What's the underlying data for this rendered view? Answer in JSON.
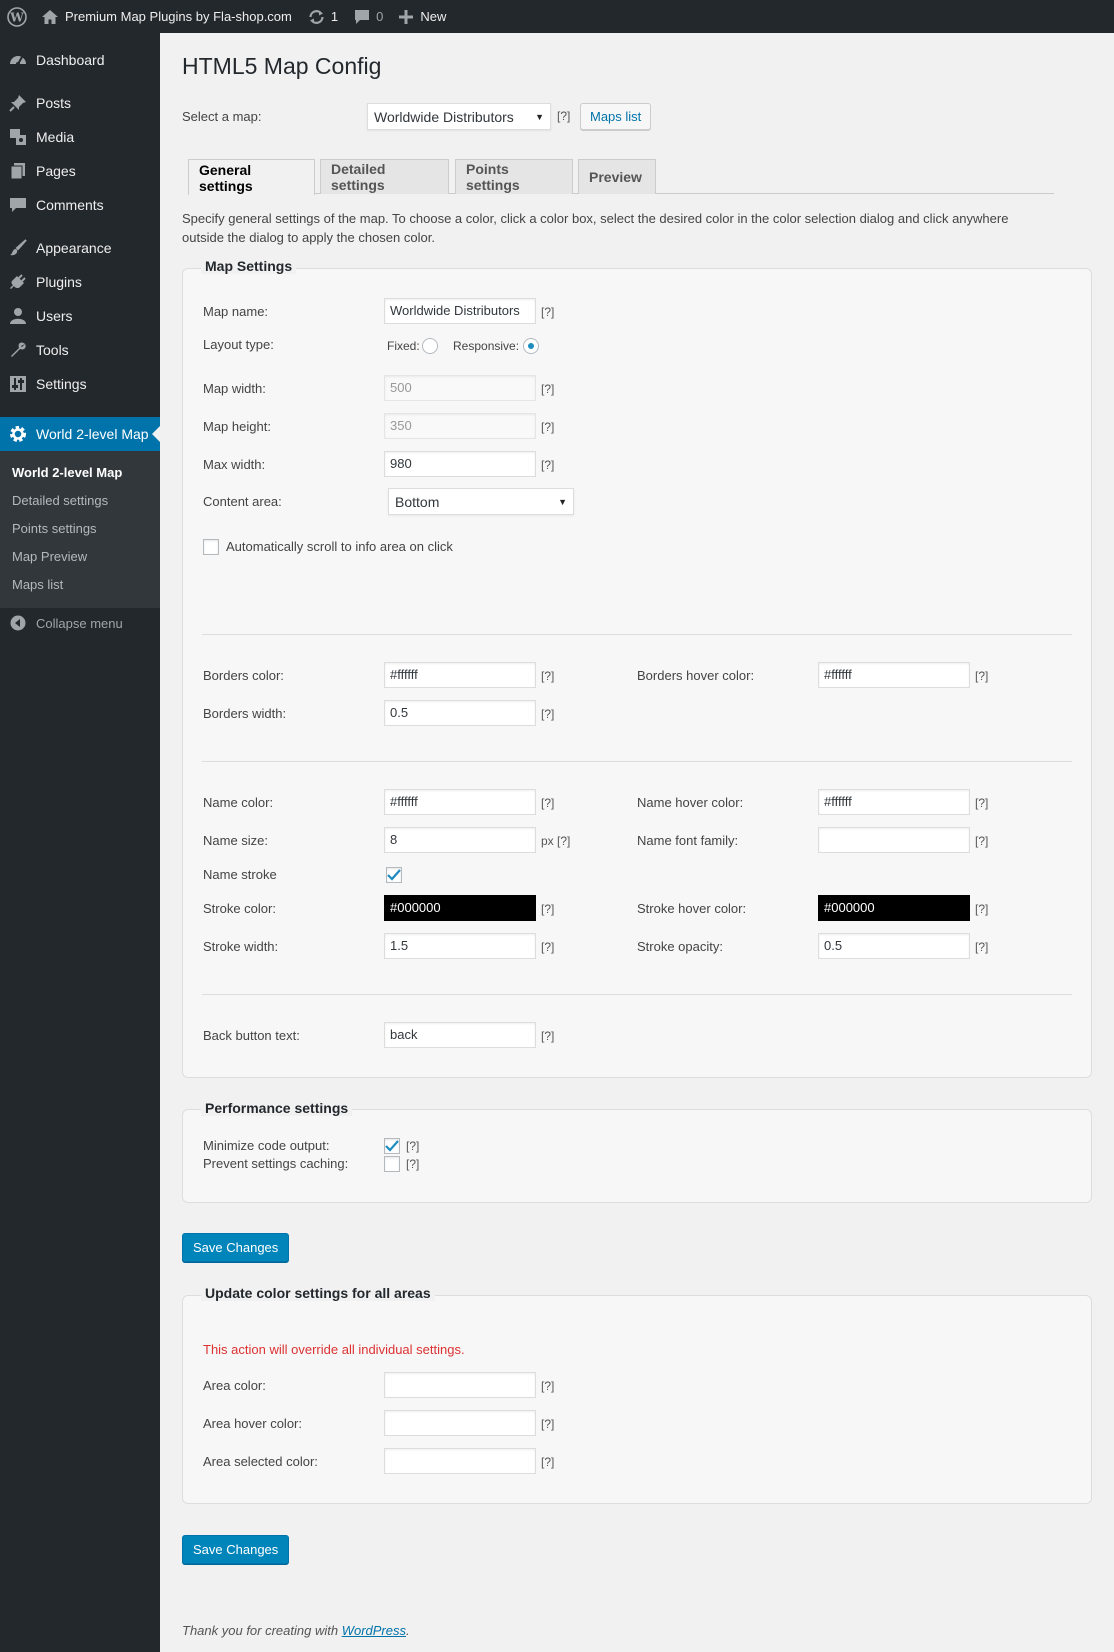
{
  "adminbar": {
    "site_name": "Premium Map Plugins by Fla-shop.com",
    "updates_count": "1",
    "comments_count": "0",
    "new_label": "New"
  },
  "sidebar": {
    "items": [
      {
        "label": "Dashboard",
        "icon": "dashboard-icon"
      },
      {
        "label": "Posts",
        "icon": "pin-icon"
      },
      {
        "label": "Media",
        "icon": "media-icon"
      },
      {
        "label": "Pages",
        "icon": "pages-icon"
      },
      {
        "label": "Comments",
        "icon": "comment-icon"
      },
      {
        "label": "Appearance",
        "icon": "brush-icon"
      },
      {
        "label": "Plugins",
        "icon": "plug-icon"
      },
      {
        "label": "Users",
        "icon": "user-icon"
      },
      {
        "label": "Tools",
        "icon": "wrench-icon"
      },
      {
        "label": "Settings",
        "icon": "sliders-icon"
      },
      {
        "label": "World 2-level Map",
        "icon": "gear-icon"
      }
    ],
    "submenu": [
      "World 2-level Map",
      "Detailed settings",
      "Points settings",
      "Map Preview",
      "Maps list"
    ],
    "collapse_label": "Collapse menu"
  },
  "page": {
    "title": "HTML5 Map Config",
    "select_map_label": "Select a map:",
    "selected_map": "Worldwide Distributors",
    "help": "[?]",
    "maps_list_button": "Maps list",
    "tabs": [
      "General settings",
      "Detailed settings",
      "Points settings",
      "Preview"
    ],
    "description": "Specify general settings of the map. To choose a color, click a color box, select the desired color in the color selection dialog and click anywhere outside the dialog to apply the chosen color."
  },
  "map_settings": {
    "legend": "Map Settings",
    "map_name_label": "Map name:",
    "map_name_value": "Worldwide Distributors",
    "layout_type_label": "Layout type:",
    "fixed_label": "Fixed:",
    "responsive_label": "Responsive:",
    "layout_selected": "Responsive",
    "map_width_label": "Map width:",
    "map_width_value": "500",
    "map_height_label": "Map height:",
    "map_height_value": "350",
    "max_width_label": "Max width:",
    "max_width_value": "980",
    "content_area_label": "Content area:",
    "content_area_value": "Bottom",
    "auto_scroll_label": "Automatically scroll to info area on click",
    "auto_scroll_checked": false,
    "borders_color_label": "Borders color:",
    "borders_color_value": "#ffffff",
    "borders_hover_color_label": "Borders hover color:",
    "borders_hover_color_value": "#ffffff",
    "borders_width_label": "Borders width:",
    "borders_width_value": "0.5",
    "name_color_label": "Name color:",
    "name_color_value": "#ffffff",
    "name_hover_color_label": "Name hover color:",
    "name_hover_color_value": "#ffffff",
    "name_size_label": "Name size:",
    "name_size_value": "8",
    "px_help": "px [?]",
    "name_font_family_label": "Name font family:",
    "name_font_family_value": "",
    "name_stroke_label": "Name stroke",
    "name_stroke_checked": true,
    "stroke_color_label": "Stroke color:",
    "stroke_color_value": "#000000",
    "stroke_hover_color_label": "Stroke hover color:",
    "stroke_hover_color_value": "#000000",
    "stroke_width_label": "Stroke width:",
    "stroke_width_value": "1.5",
    "stroke_opacity_label": "Stroke opacity:",
    "stroke_opacity_value": "0.5",
    "back_button_text_label": "Back button text:",
    "back_button_text_value": "back"
  },
  "performance": {
    "legend": "Performance settings",
    "minimize_label": "Minimize code output:",
    "minimize_checked": true,
    "prevent_cache_label": "Prevent settings caching:",
    "prevent_cache_checked": false
  },
  "save_button": "Save Changes",
  "update_colors": {
    "legend": "Update color settings for all areas",
    "warning": "This action will override all individual settings.",
    "area_color_label": "Area color:",
    "area_color_value": "",
    "area_hover_color_label": "Area hover color:",
    "area_hover_color_value": "",
    "area_selected_color_label": "Area selected color:",
    "area_selected_color_value": ""
  },
  "footer": {
    "prefix": "Thank you for creating with ",
    "link": "WordPress",
    "suffix": "."
  },
  "colors": {
    "adminbar_bg": "#23282d",
    "accent": "#0073aa",
    "primary_button": "#0085ba",
    "warning": "#dc3232"
  }
}
